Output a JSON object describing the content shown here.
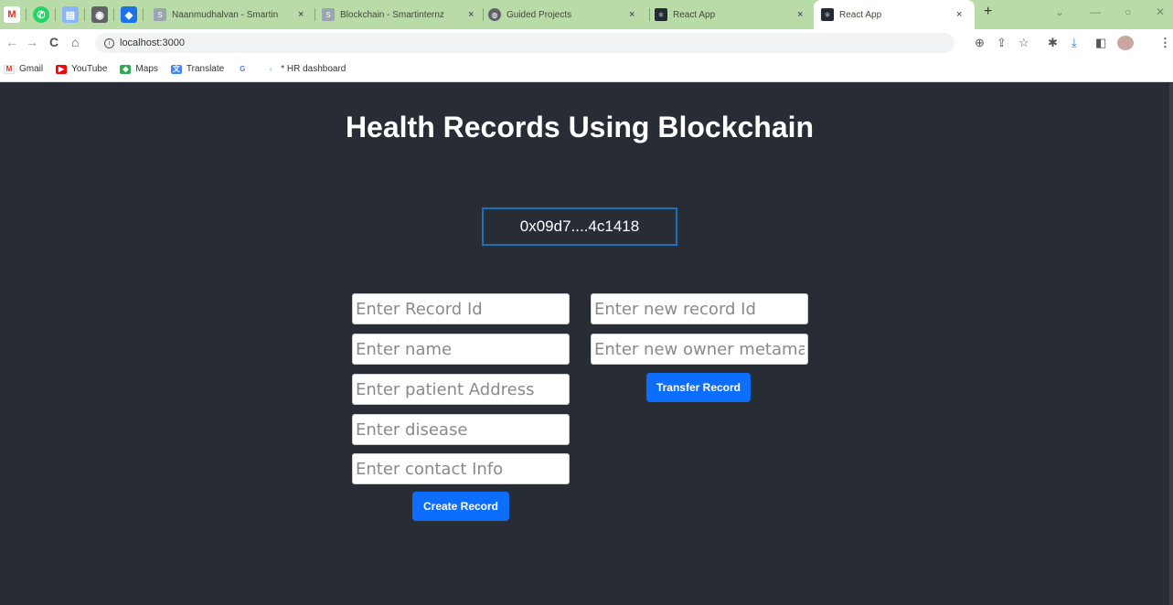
{
  "browser": {
    "tabs": [
      {
        "title": "Naanmudhalvan - Smartin",
        "close": "×"
      },
      {
        "title": "Blockchain - Smartinternz",
        "close": "×"
      },
      {
        "title": "Guided Projects",
        "close": "×"
      },
      {
        "title": "React App",
        "close": "×"
      },
      {
        "title": "React App",
        "close": "×",
        "active": true
      }
    ],
    "new_tab": "+",
    "url": "localhost:3000",
    "bookmarks": [
      "Gmail",
      "YouTube",
      "Maps",
      "Translate",
      "* HR dashboard"
    ]
  },
  "app": {
    "title": "Health Records Using Blockchain",
    "account": "0x09d7....4c1418",
    "create_form": {
      "record_id_placeholder": "Enter Record Id",
      "name_placeholder": "Enter name",
      "patient_address_placeholder": "Enter patient Address",
      "disease_placeholder": "Enter disease",
      "contact_info_placeholder": "Enter contact Info",
      "submit_label": "Create Record"
    },
    "transfer_form": {
      "new_record_id_placeholder": "Enter new record Id",
      "new_owner_placeholder": "Enter new owner metamask address",
      "submit_label": "Transfer Record"
    }
  },
  "colors": {
    "page_background": "#282c34",
    "button_primary": "#0d6efd",
    "account_border": "#1e6fb8",
    "tabbar": "#b9dba8"
  }
}
